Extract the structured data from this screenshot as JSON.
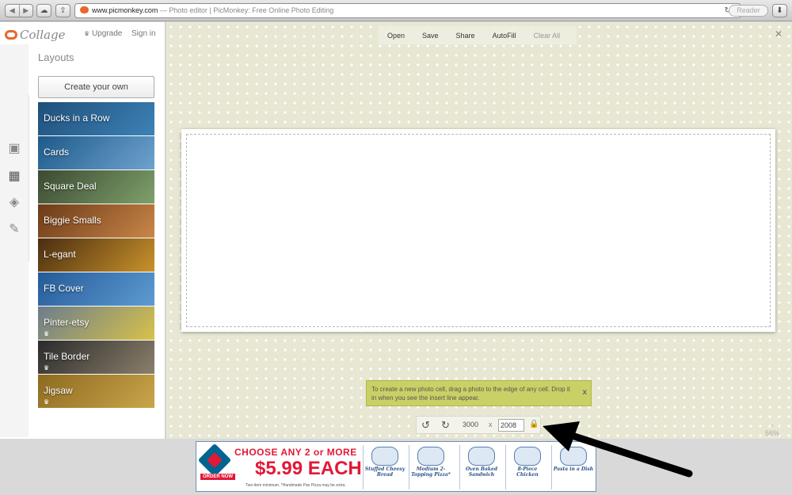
{
  "browser": {
    "back_glyph": "◀",
    "forward_glyph": "▶",
    "url_host": "www.picmonkey.com",
    "url_title": " — Photo editor | PicMonkey: Free Online Photo Editing",
    "reload_glyph": "↻",
    "reader_label": "Reader"
  },
  "sidebar": {
    "app_name": "Collage",
    "upgrade_label": "Upgrade",
    "signin_label": "Sign in",
    "section_title": "Layouts",
    "create_label": "Create your own",
    "rail_icons": [
      "image-icon",
      "layout-icon",
      "tag-icon",
      "palette-icon"
    ],
    "layouts": [
      {
        "label": "Ducks in a Row",
        "premium": false,
        "colors": [
          "#1f4f7a",
          "#3d82b7"
        ]
      },
      {
        "label": "Cards",
        "premium": false,
        "colors": [
          "#1d5a8a",
          "#6fa3cf"
        ]
      },
      {
        "label": "Square Deal",
        "premium": false,
        "colors": [
          "#3b4a32",
          "#7ea06a"
        ]
      },
      {
        "label": "Biggie Smalls",
        "premium": false,
        "colors": [
          "#6b3a17",
          "#c98648"
        ]
      },
      {
        "label": "L-egant",
        "premium": false,
        "colors": [
          "#4a2d10",
          "#c9922c"
        ]
      },
      {
        "label": "FB Cover",
        "premium": false,
        "colors": [
          "#245a96",
          "#5e9bd3"
        ]
      },
      {
        "label": "Pinter-etsy",
        "premium": true,
        "colors": [
          "#6b7d8c",
          "#d7c24a"
        ]
      },
      {
        "label": "Tile Border",
        "premium": true,
        "colors": [
          "#2b2b2b",
          "#8a7f6a"
        ]
      },
      {
        "label": "Jigsaw",
        "premium": true,
        "colors": [
          "#8e6a20",
          "#c9a54a"
        ]
      }
    ]
  },
  "canvas": {
    "menu": [
      "Open",
      "Save",
      "Share",
      "AutoFill",
      "Clear All"
    ],
    "tip_text": "To create a new photo cell, drag a photo to the edge of any cell. Drop it in when you see the insert line appear.",
    "tip_close": "x",
    "width_value": "3000",
    "times_label": "x",
    "height_value": "2008",
    "zoom_label": "56%"
  },
  "ad": {
    "headline": "CHOOSE ANY 2 or MORE",
    "price": "$5.99 EACH",
    "fine_print": "Two-item minimum. *Handmade Pan Pizza may be extra.",
    "order_label": "ORDER NOW",
    "items": [
      "Stuffed Cheesy Bread",
      "Medium 2-Topping Pizza*",
      "Oven Baked Sandwich",
      "8-Piece Chicken",
      "Pasta in a Dish"
    ]
  }
}
